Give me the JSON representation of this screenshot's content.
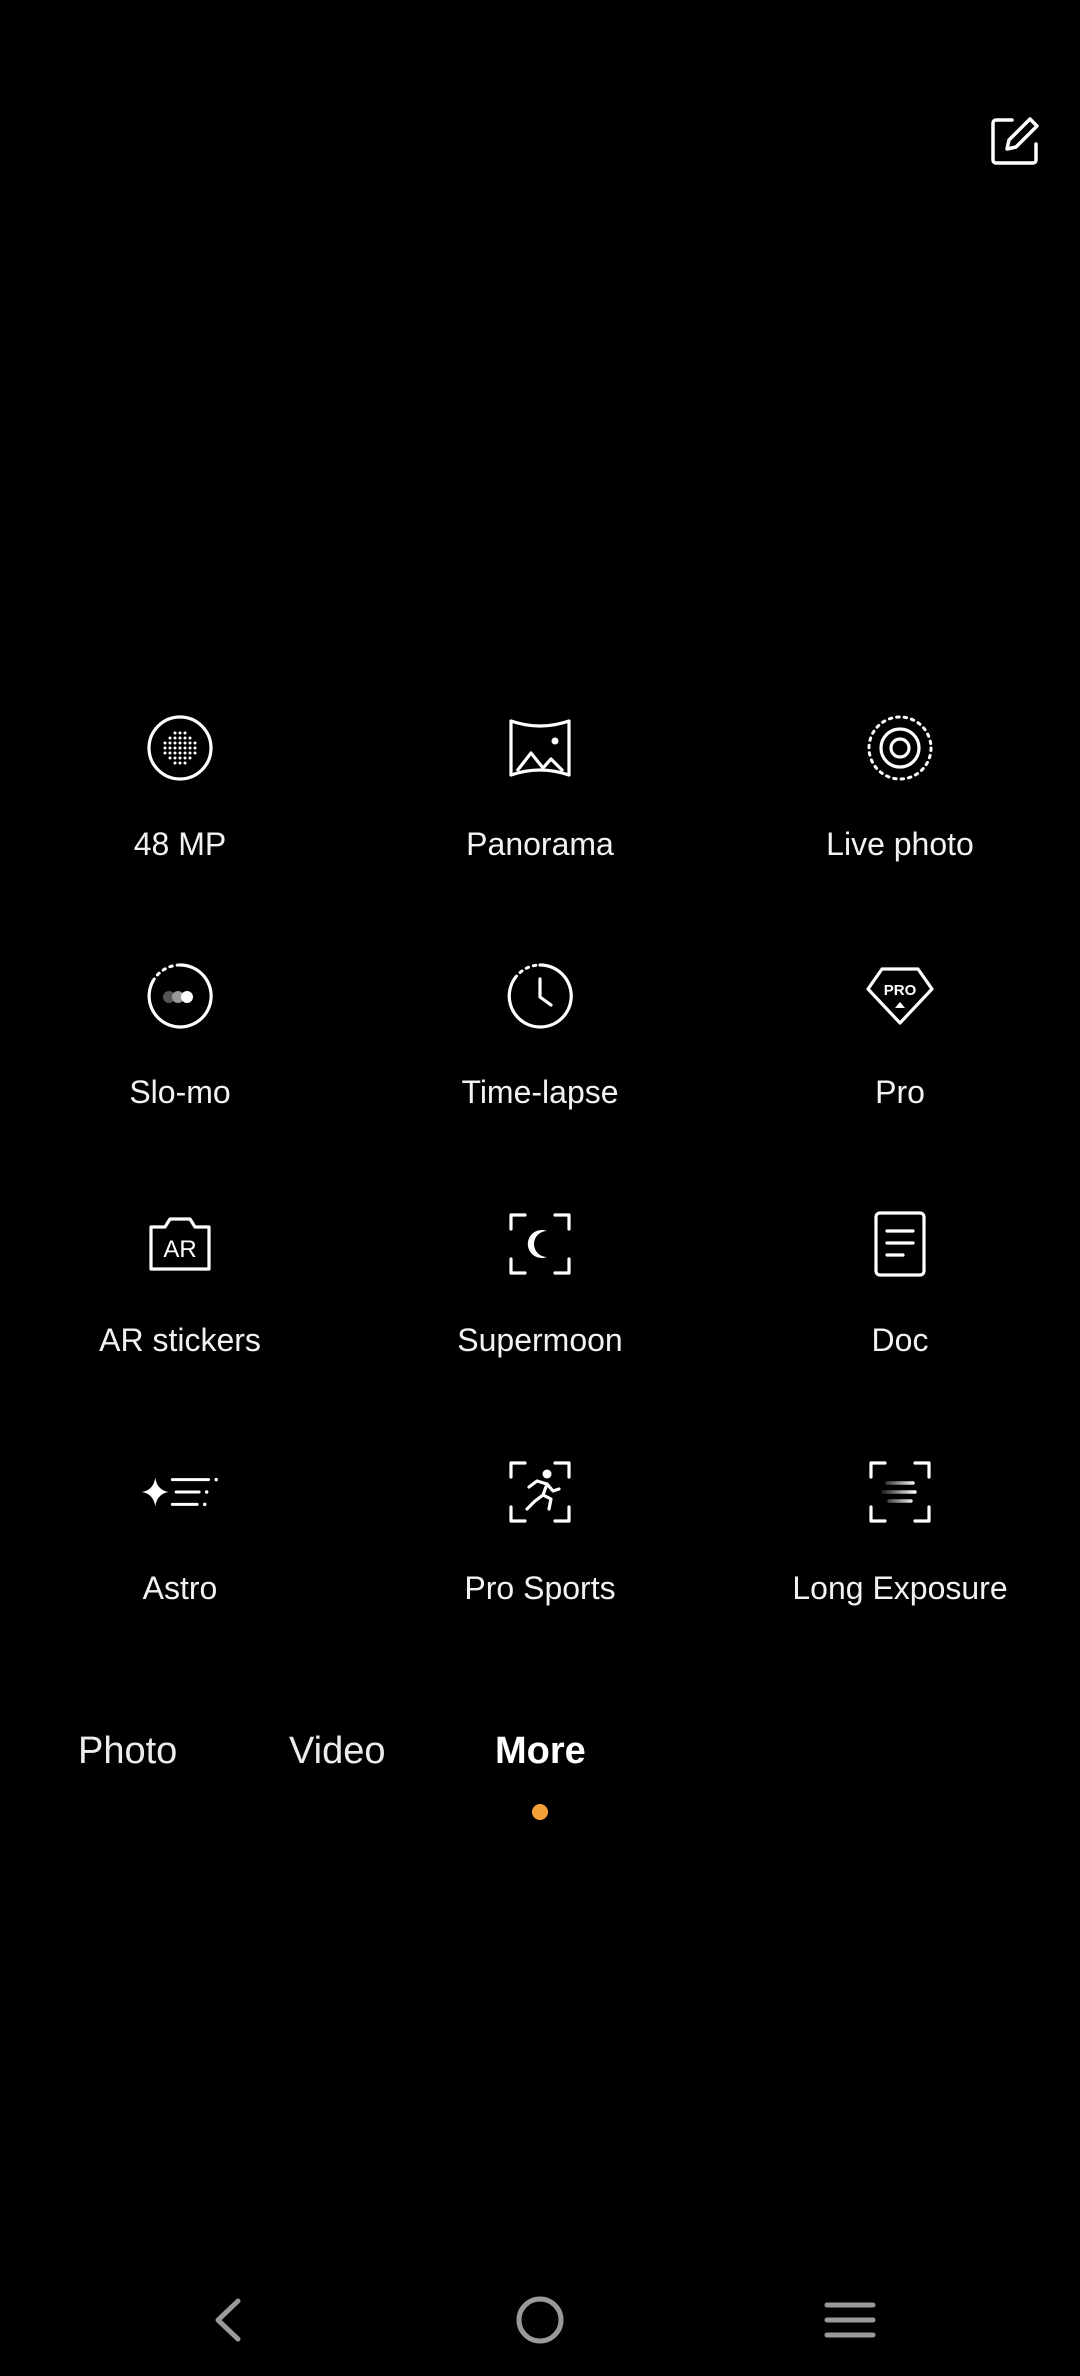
{
  "toolbar": {
    "edit_icon": "edit-square-icon"
  },
  "modes": [
    {
      "label": "48 MP",
      "icon": "dot-matrix-circle-icon"
    },
    {
      "label": "Panorama",
      "icon": "panorama-icon"
    },
    {
      "label": "Live photo",
      "icon": "live-photo-icon"
    },
    {
      "label": "Slo-mo",
      "icon": "slow-motion-icon"
    },
    {
      "label": "Time-lapse",
      "icon": "clock-icon"
    },
    {
      "label": "Pro",
      "icon": "pro-badge-icon",
      "badge_text": "PRO"
    },
    {
      "label": "AR stickers",
      "icon": "ar-camera-icon",
      "badge_text": "AR"
    },
    {
      "label": "Supermoon",
      "icon": "moon-frame-icon"
    },
    {
      "label": "Doc",
      "icon": "document-icon"
    },
    {
      "label": "Astro",
      "icon": "sparkle-lines-icon"
    },
    {
      "label": "Pro Sports",
      "icon": "runner-frame-icon"
    },
    {
      "label": "Long Exposure",
      "icon": "motion-lines-frame-icon"
    }
  ],
  "tabs": [
    {
      "label": "Photo",
      "active": false
    },
    {
      "label": "Video",
      "active": false
    },
    {
      "label": "More",
      "active": true
    }
  ],
  "colors": {
    "background": "#000000",
    "accent": "#f4a13a",
    "icon": "#ffffff"
  },
  "navbar": {
    "back_icon": "back-chevron-icon",
    "home_icon": "home-circle-icon",
    "menu_icon": "menu-lines-icon"
  }
}
